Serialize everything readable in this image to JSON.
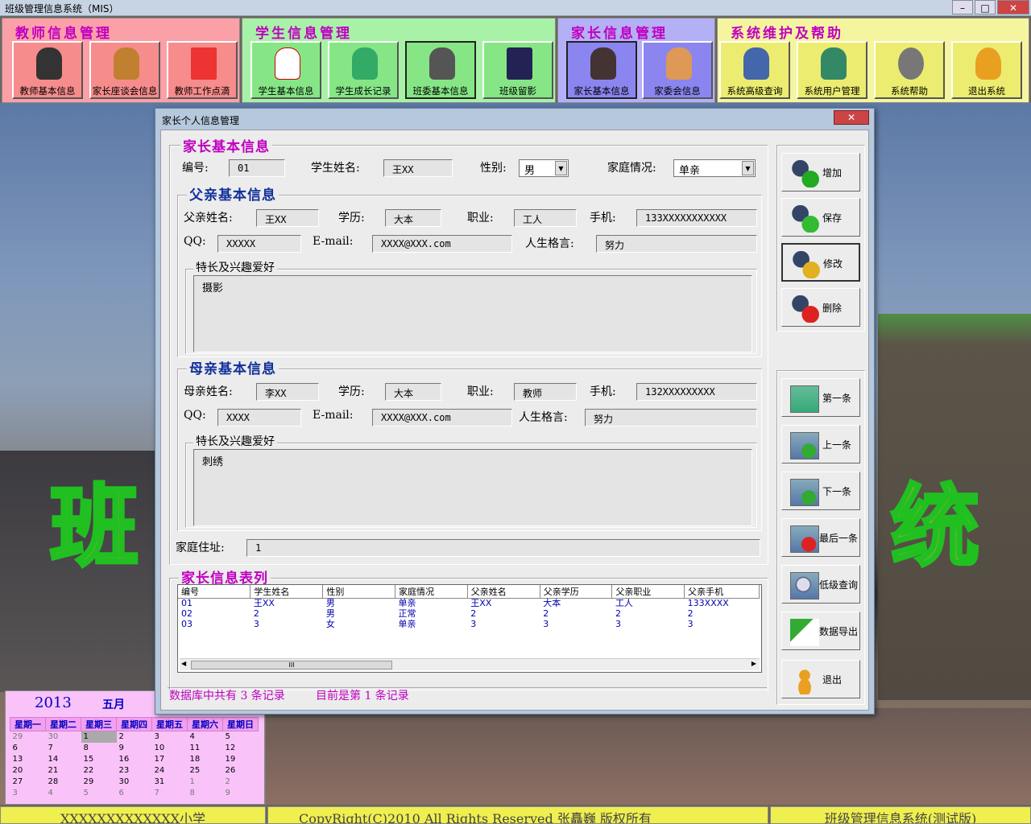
{
  "window": {
    "title": "班级管理信息系统（MIS）",
    "min_label": "–",
    "max_label": "□",
    "close_label": "✕"
  },
  "menus": [
    {
      "title": "教师信息管理",
      "buttons": [
        "教师基本信息",
        "家长座谈会信息",
        "教师工作点滴"
      ]
    },
    {
      "title": "学生信息管理",
      "buttons": [
        "学生基本信息",
        "学生成长记录",
        "班委基本信息",
        "班级留影"
      ]
    },
    {
      "title": "家长信息管理",
      "buttons": [
        "家长基本信息",
        "家委会信息"
      ]
    },
    {
      "title": "系统维护及帮助",
      "buttons": [
        "系统高级查询",
        "系统用户管理",
        "系统帮助",
        "退出系统"
      ]
    }
  ],
  "decor": {
    "left_char": "班",
    "right_char": "统"
  },
  "calendar": {
    "year": "2013",
    "month": "五月",
    "weekdays": [
      "星期一",
      "星期二",
      "星期三",
      "星期四",
      "星期五",
      "星期六",
      "星期日"
    ],
    "weeks": [
      [
        "29",
        "30",
        "1",
        "2",
        "3",
        "4",
        "5"
      ],
      [
        "6",
        "7",
        "8",
        "9",
        "10",
        "11",
        "12"
      ],
      [
        "13",
        "14",
        "15",
        "16",
        "17",
        "18",
        "19"
      ],
      [
        "20",
        "21",
        "22",
        "23",
        "24",
        "25",
        "26"
      ],
      [
        "27",
        "28",
        "29",
        "30",
        "31",
        "1",
        "2"
      ],
      [
        "3",
        "4",
        "5",
        "6",
        "7",
        "8",
        "9"
      ]
    ]
  },
  "statusbar": {
    "school": "XXXXXXXXXXXXX小学",
    "copyright": "CopyRight(C)2010  All Rights Reserved 张矗巍  版权所有",
    "system": "班级管理信息系统(测试版)"
  },
  "dialog": {
    "title": "家长个人信息管理",
    "close_label": "✕",
    "basic": {
      "title": "家长基本信息",
      "id_label": "编号:",
      "id_value": "01",
      "student_label": "学生姓名:",
      "student_value": "王XX",
      "gender_label": "性别:",
      "gender_value": "男",
      "family_label": "家庭情况:",
      "family_value": "单亲"
    },
    "father": {
      "title": "父亲基本信息",
      "name_label": "父亲姓名:",
      "name_value": "王XX",
      "edu_label": "学历:",
      "edu_value": "大本",
      "job_label": "职业:",
      "job_value": "工人",
      "phone_label": "手机:",
      "phone_value": "133XXXXXXXXXXX",
      "qq_label": "QQ:",
      "qq_value": "XXXXX",
      "email_label": "E-mail:",
      "email_value": "XXXX@XXX.com",
      "motto_label": "人生格言:",
      "motto_value": "努力",
      "hobby_label": "特长及兴趣爱好",
      "hobby_value": "摄影"
    },
    "mother": {
      "title": "母亲基本信息",
      "name_label": "母亲姓名:",
      "name_value": "李XX",
      "edu_label": "学历:",
      "edu_value": "大本",
      "job_label": "职业:",
      "job_value": "教师",
      "phone_label": "手机:",
      "phone_value": "132XXXXXXXXX",
      "qq_label": "QQ:",
      "qq_value": "XXXX",
      "email_label": "E-mail:",
      "email_value": "XXXX@XXX.com",
      "motto_label": "人生格言:",
      "motto_value": "努力",
      "hobby_label": "特长及兴趣爱好",
      "hobby_value": "刺绣"
    },
    "address_label": "家庭住址:",
    "address_value": "1",
    "list": {
      "title": "家长信息表列",
      "columns": [
        "编号",
        "学生姓名",
        "性别",
        "家庭情况",
        "父亲姓名",
        "父亲学历",
        "父亲职业",
        "父亲手机"
      ],
      "rows": [
        [
          "01",
          "王XX",
          "男",
          "单亲",
          "王XX",
          "大本",
          "工人",
          "133XXXX"
        ],
        [
          "02",
          "2",
          "男",
          "正常",
          "2",
          "2",
          "2",
          "2"
        ],
        [
          "03",
          "3",
          "女",
          "单亲",
          "3",
          "3",
          "3",
          "3"
        ]
      ],
      "scroll_grip": "III"
    },
    "count_text": "数据库中共有 3 条记录",
    "current_text": "目前是第 1 条记录",
    "actions": [
      "增加",
      "保存",
      "修改",
      "删除"
    ],
    "nav": [
      "第一条",
      "上一条",
      "下一条",
      "最后一条",
      "低级查询",
      "数据导出",
      "退出"
    ]
  },
  "colors": {
    "teacher": "#fca0a8",
    "student": "#a8f2a8",
    "parent": "#b4b0f6",
    "system": "#f5f5a0",
    "accent_pink": "#c000c0",
    "accent_navy": "#10309a"
  }
}
